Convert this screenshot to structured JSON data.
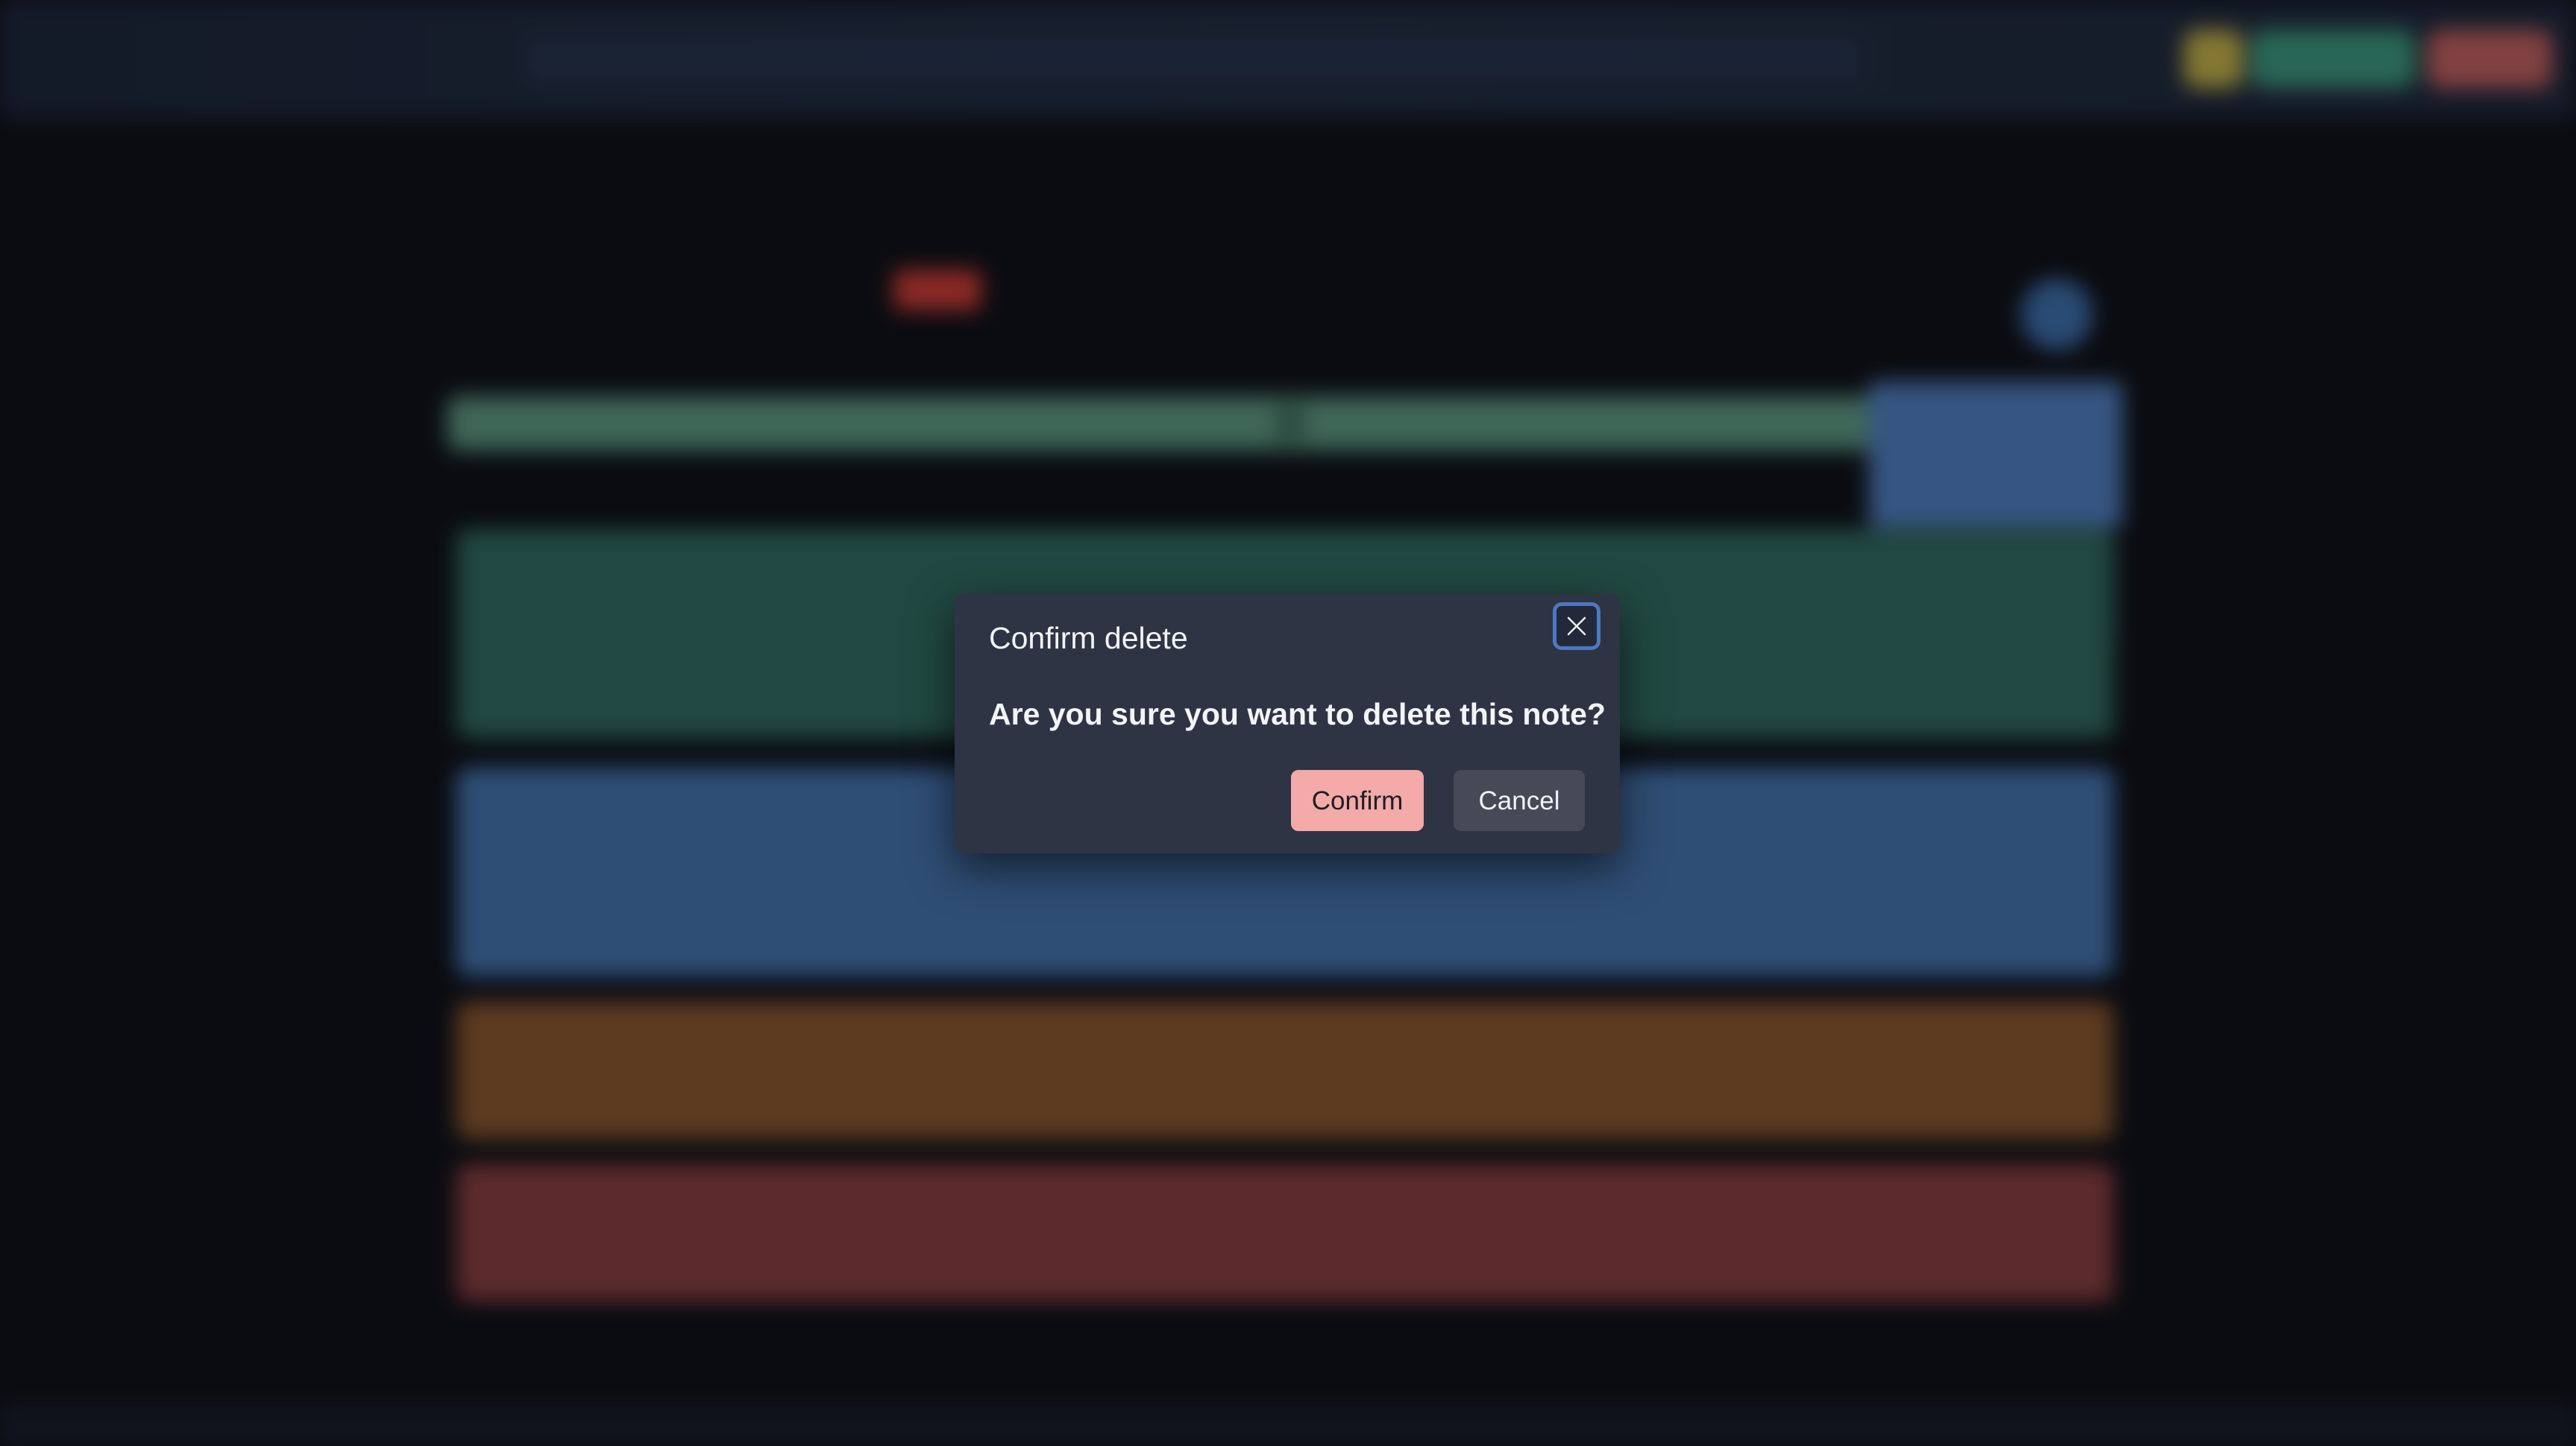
{
  "dialog": {
    "title": "Confirm delete",
    "message": "Are you sure you want to delete this note?",
    "confirm_label": "Confirm",
    "cancel_label": "Cancel",
    "close_icon": "close-icon"
  },
  "background": {
    "blurred": true,
    "colors": {
      "topbar": "#1f2a3d",
      "note_green": "#2f6a5e",
      "note_blue": "#4474ad",
      "note_orange": "#8a562b",
      "note_red": "#893d3d",
      "progress": "#5d9a80",
      "confirm_button": "#f3aaa8",
      "accent_focus": "#4b79c2"
    },
    "swatch_colors": [
      "#c0413f",
      "#3f8f52",
      "#2f6a5e",
      "#3d5f94",
      "#c9a23b",
      "#c0702e",
      "#7b7f87",
      "#b0437e"
    ]
  }
}
